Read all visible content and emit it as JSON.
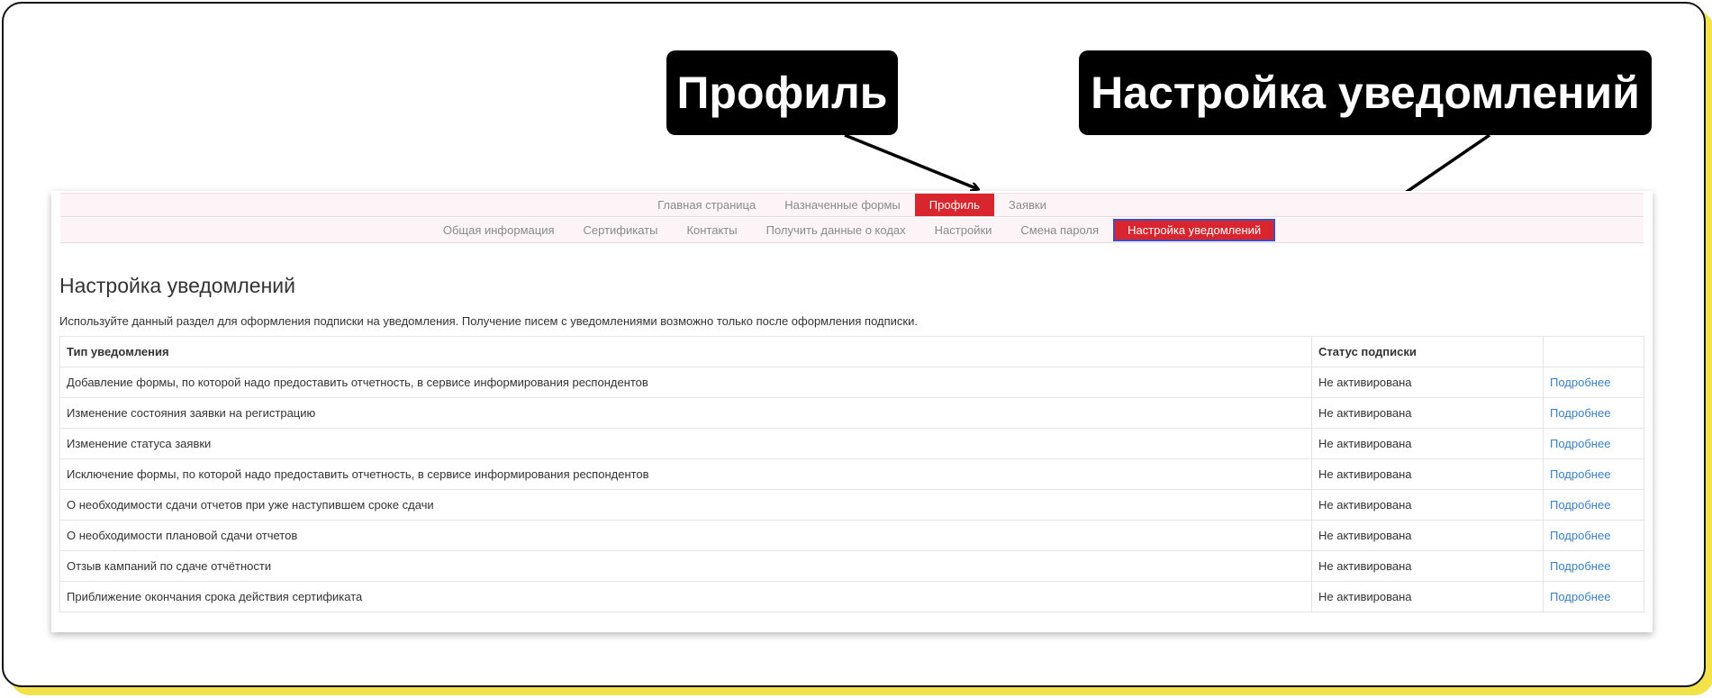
{
  "callouts": {
    "profile": "Профиль",
    "notifications": "Настройка уведомлений"
  },
  "top_nav": [
    {
      "label": "Главная страница",
      "active": false
    },
    {
      "label": "Назначенные формы",
      "active": false
    },
    {
      "label": "Профиль",
      "active": true
    },
    {
      "label": "Заявки",
      "active": false
    }
  ],
  "sub_nav": [
    {
      "label": "Общая информация",
      "active": false
    },
    {
      "label": "Сертификаты",
      "active": false
    },
    {
      "label": "Контакты",
      "active": false
    },
    {
      "label": "Получить данные о кодах",
      "active": false
    },
    {
      "label": "Настройки",
      "active": false
    },
    {
      "label": "Смена пароля",
      "active": false
    },
    {
      "label": "Настройка уведомлений",
      "active": true
    }
  ],
  "page": {
    "title": "Настройка уведомлений",
    "intro": "Используйте данный раздел для оформления подписки на уведомления. Получение писем с уведомлениями возможно только после оформления подписки."
  },
  "table": {
    "headers": {
      "type": "Тип уведомления",
      "status": "Статус подписки",
      "action": ""
    },
    "rows": [
      {
        "type": "Добавление формы, по которой надо предоставить отчетность, в сервисе информирования респондентов",
        "status": "Не активирована",
        "action": "Подробнее"
      },
      {
        "type": "Изменение состояния заявки на регистрацию",
        "status": "Не активирована",
        "action": "Подробнее"
      },
      {
        "type": "Изменение статуса заявки",
        "status": "Не активирована",
        "action": "Подробнее"
      },
      {
        "type": "Исключение формы, по которой надо предоставить отчетность, в сервисе информирования респондентов",
        "status": "Не активирована",
        "action": "Подробнее"
      },
      {
        "type": "О необходимости сдачи отчетов при уже наступившем сроке сдачи",
        "status": "Не активирована",
        "action": "Подробнее"
      },
      {
        "type": "О необходимости плановой сдачи отчетов",
        "status": "Не активирована",
        "action": "Подробнее"
      },
      {
        "type": "Отзыв кампаний по сдаче отчётности",
        "status": "Не активирована",
        "action": "Подробнее"
      },
      {
        "type": "Приближение окончания срока действия сертификата",
        "status": "Не активирована",
        "action": "Подробнее"
      }
    ]
  },
  "colors": {
    "active_tab": "#d9262e",
    "link": "#3a7fc4",
    "highlight_frame": "#f4e24a"
  }
}
